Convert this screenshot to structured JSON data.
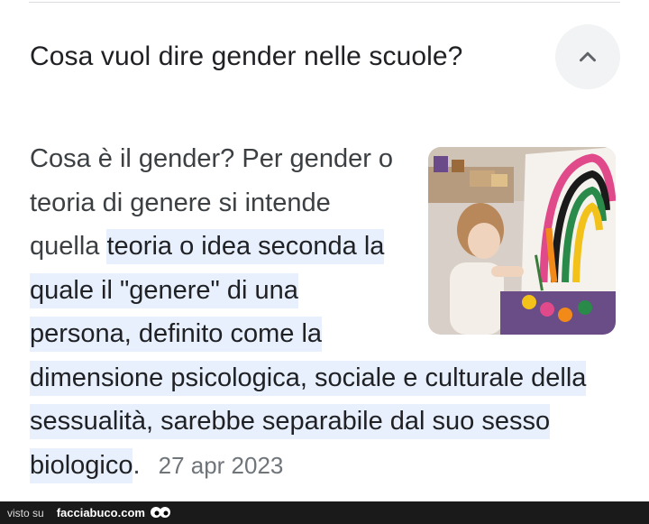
{
  "faq": {
    "question": "Cosa vuol dire gender nelle scuole?",
    "toggle_icon": "chevron-up-icon",
    "answer_lead": "Cosa è il gender? Per gender o teoria di genere si intende quella ",
    "answer_highlight": "teoria o idea seconda la quale il \"genere\" di una persona, definito come la dimensione psicologica, sociale e culturale della sessualità, sarebbe separabile dal suo sesso biologico",
    "answer_tail": ".",
    "date": "27 apr 2023",
    "thumbnail_icon": "child-painting-rainbow-image"
  },
  "footer": {
    "visto": "visto su",
    "site": "facciabuco.com",
    "mascot_icon": "eyes-icon"
  },
  "colors": {
    "highlight": "#e8f0fe",
    "text": "#202124",
    "muted": "#70757a",
    "button_bg": "#f1f3f4",
    "footer_bg": "#1a1a1a"
  }
}
